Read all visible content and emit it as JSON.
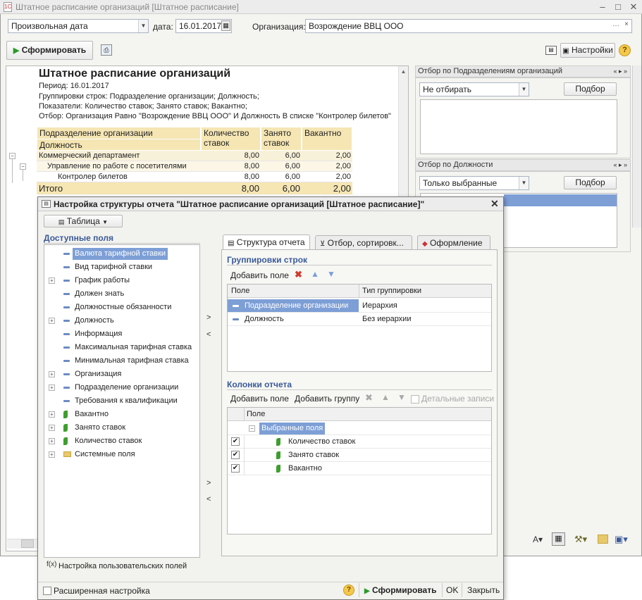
{
  "window": {
    "title": "Штатное расписание организаций [Штатное расписание]",
    "min": "‒",
    "max": "□",
    "close": "✕"
  },
  "top": {
    "period_type": "Произвольная дата",
    "date_label": "дата:",
    "date_value": "16.01.2017",
    "org_label": "Организация:",
    "org_value": "Возрождение ВВЦ ООО",
    "form_button": "Сформировать",
    "settings_button": "Настройки"
  },
  "report": {
    "title": "Штатное расписание организаций",
    "period": "Период: 16.01.2017",
    "groupings": "Группировки строк: Подразделение организации; Должность;",
    "indicators": "Показатели: Количество ставок; Занято ставок; Вакантно;",
    "filter": "Отбор: Организация Равно \"Возрождение ВВЦ ООО\" И Должность В списке \"Контролер билетов\"",
    "headers": {
      "col1a": "Подразделение организации",
      "col1b": "Должность",
      "col2a": "Количество",
      "col2b": "ставок",
      "col3a": "Занято",
      "col3b": "ставок",
      "col4": "Вакантно"
    },
    "rows": [
      {
        "name": "Коммерческий департамент",
        "qty": "8,00",
        "busy": "6,00",
        "vac": "2,00"
      },
      {
        "name": "Управление по работе с посетителями",
        "qty": "8,00",
        "busy": "6,00",
        "vac": "2,00"
      },
      {
        "name": "Контролер билетов",
        "qty": "8,00",
        "busy": "6,00",
        "vac": "2,00"
      }
    ],
    "total": {
      "name": "Итого",
      "qty": "8,00",
      "busy": "6,00",
      "vac": "2,00"
    }
  },
  "side": {
    "panel1": {
      "title": "Отбор по Подразделениям организаций",
      "select": "Не отбирать",
      "button": "Подбор"
    },
    "panel2": {
      "title": "Отбор по Должности",
      "select": "Только выбранные",
      "button": "Подбор"
    }
  },
  "dialog": {
    "title": "Настройка структуры отчета \"Штатное расписание организаций [Штатное расписание]\"",
    "view_button": "Таблица",
    "available_title": "Доступные поля",
    "fields": [
      {
        "label": "Валюта тарифной ставки",
        "kind": "field",
        "expand": false
      },
      {
        "label": "Вид тарифной ставки",
        "kind": "field",
        "expand": false
      },
      {
        "label": "График работы",
        "kind": "field",
        "expand": true
      },
      {
        "label": "Должен знать",
        "kind": "field",
        "expand": false
      },
      {
        "label": "Должностные обязанности",
        "kind": "field",
        "expand": false
      },
      {
        "label": "Должность",
        "kind": "field",
        "expand": true
      },
      {
        "label": "Информация",
        "kind": "field",
        "expand": false
      },
      {
        "label": "Максимальная тарифная ставка",
        "kind": "field",
        "expand": false
      },
      {
        "label": "Минимальная тарифная ставка",
        "kind": "field",
        "expand": false
      },
      {
        "label": "Организация",
        "kind": "field",
        "expand": true
      },
      {
        "label": "Подразделение организации",
        "kind": "field",
        "expand": true
      },
      {
        "label": "Требования к квалификации",
        "kind": "field",
        "expand": false
      },
      {
        "label": "Вакантно",
        "kind": "number",
        "expand": true
      },
      {
        "label": "Занято ставок",
        "kind": "number",
        "expand": true
      },
      {
        "label": "Количество ставок",
        "kind": "number",
        "expand": true
      },
      {
        "label": "Системные поля",
        "kind": "folder",
        "expand": true
      }
    ],
    "custom_fields_link": "Настройка пользовательских полей",
    "move_right": ">",
    "move_left": "<",
    "tabs": [
      "Структура отчета",
      "Отбор, сортировк...",
      "Оформление"
    ],
    "row_groups_title": "Группировки строк",
    "add_field": "Добавить поле",
    "groups_header": {
      "field": "Поле",
      "type": "Тип группировки"
    },
    "groups": [
      {
        "field": "Подразделение организации",
        "type": "Иерархия"
      },
      {
        "field": "Должность",
        "type": "Без иерархии"
      }
    ],
    "columns_title": "Колонки отчета",
    "add_group": "Добавить группу",
    "detail_records": "Детальные записи",
    "columns_header": "Поле",
    "selected_fields": "Выбранные поля",
    "columns": [
      "Количество ставок",
      "Занято ставок",
      "Вакантно"
    ],
    "extended": "Расширенная настройка",
    "bottom_form": "Сформировать",
    "ok": "OK",
    "close": "Закрыть"
  }
}
